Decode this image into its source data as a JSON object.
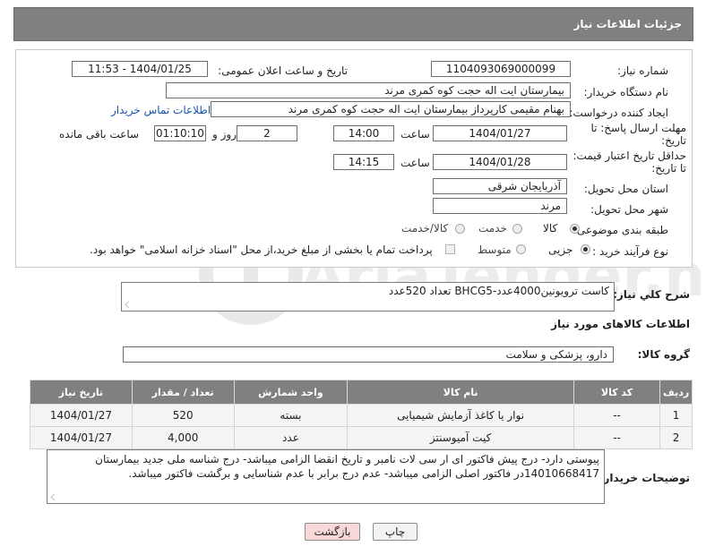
{
  "header": {
    "title": "جزئیات اطلاعات نیاز"
  },
  "form": {
    "need_number_label": "شماره نیاز:",
    "need_number": "1104093069000099",
    "announce_label": "تاریخ و ساعت اعلان عمومی:",
    "announce_value": "1404/01/25 - 11:53",
    "buyer_org_label": "نام دستگاه خریدار:",
    "buyer_org": "بیمارستان ایت اله حجت کوه کمری مرند",
    "creator_label": "ایجاد کننده درخواست:",
    "creator": "بهنام مقیمی کارپرداز بیمارستان ایت اله حجت کوه کمری مرند",
    "contact_link": "اطلاعات تماس خریدار",
    "deadline_label": "مهلت ارسال پاسخ: تا تاریخ:",
    "deadline_date": "1404/01/27",
    "time_label": "ساعت",
    "deadline_time": "14:00",
    "days_value": "2",
    "days_label": "روز و",
    "remaining_value": "01:10:10",
    "remaining_label": "ساعت باقی مانده",
    "validity_label": "حداقل تاریخ اعتبار قیمت: تا تاریخ:",
    "validity_date": "1404/01/28",
    "validity_time": "14:15",
    "province_label": "استان محل تحویل:",
    "province": "آذربایجان شرقی",
    "city_label": "شهر محل تحویل:",
    "city": "مرند",
    "category_label": "طبقه بندی موضوعی:",
    "category_options": [
      "کالا",
      "خدمت",
      "کالا/خدمت"
    ],
    "process_label": "نوع فرآیند خرید :",
    "process_options": [
      "جزیی",
      "متوسط"
    ],
    "payment_note": "پرداخت تمام یا بخشی از مبلغ خرید،از محل \"اسناد خزانه اسلامی\" خواهد بود."
  },
  "summary": {
    "label": "شرح کلي نياز:",
    "text": "کاست ترویونین4000عدد-BHCG5  تعداد 520عدد"
  },
  "goods_section": {
    "title": "اطلاعات کالاهای مورد نیاز"
  },
  "goods_group": {
    "label": "گروه کالا:",
    "value": "دارو، پزشکی و سلامت"
  },
  "table": {
    "headers": [
      "ردیف",
      "کد کالا",
      "نام کالا",
      "واحد شمارش",
      "تعداد / مقدار",
      "تاریخ نیاز"
    ],
    "rows": [
      [
        "1",
        "--",
        "نوار یا کاغذ آزمایش شیمیایی",
        "بسته",
        "520",
        "1404/01/27"
      ],
      [
        "2",
        "--",
        "کیت آمیوسنتز",
        "عدد",
        "4,000",
        "1404/01/27"
      ]
    ]
  },
  "buyer_notes": {
    "label": "توضیحات خریدار:",
    "text": "پیوستی دارد- درج پیش فاکتور ای ار سی لات نامبر و تاریخ انقضا الزامی میباشد- درج شناسه ملی  جدید بیمارستان 14010668417در فاکتور اصلی الزامی میباشد- عدم درج برابر با عدم شناسایی و برگشت فاکتور میباشد."
  },
  "buttons": {
    "print": "چاپ",
    "back": "بازگشت"
  },
  "watermark": {
    "text": "AriaTender.neT"
  },
  "colors": {
    "header_bg": "#808080",
    "link": "#1a55b0",
    "back_button_bg": "#f7d7d7"
  }
}
